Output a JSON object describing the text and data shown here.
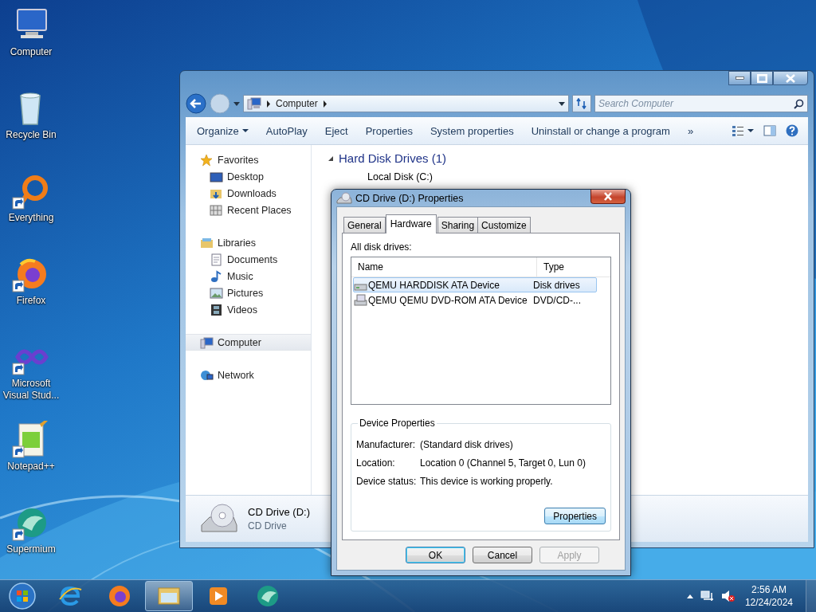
{
  "desktop_icons": [
    {
      "label": "Computer"
    },
    {
      "label": "Recycle Bin"
    },
    {
      "label": "Everything",
      "shortcut": true
    },
    {
      "label": "Firefox",
      "shortcut": true
    },
    {
      "label": "Microsoft Visual Stud...",
      "shortcut": true
    },
    {
      "label": "Notepad++",
      "shortcut": true
    },
    {
      "label": "Supermium",
      "shortcut": true
    }
  ],
  "explorer": {
    "address": {
      "crumbs": [
        "Computer"
      ]
    },
    "search": {
      "placeholder": "Search Computer"
    },
    "toolbar": [
      {
        "label": "Organize",
        "kind": "menu"
      },
      {
        "label": "AutoPlay",
        "kind": "button"
      },
      {
        "label": "Eject",
        "kind": "button"
      },
      {
        "label": "Properties",
        "kind": "button"
      },
      {
        "label": "System properties",
        "kind": "button"
      },
      {
        "label": "Uninstall or change a program",
        "kind": "button"
      },
      {
        "label": "»",
        "kind": "overflow"
      }
    ],
    "sidebar": [
      {
        "label": "Favorites",
        "selected": false,
        "children": [
          {
            "label": "Desktop",
            "selected": false
          },
          {
            "label": "Downloads",
            "selected": false
          },
          {
            "label": "Recent Places",
            "selected": false
          }
        ]
      },
      {
        "label": "Libraries",
        "selected": false,
        "children": [
          {
            "label": "Documents",
            "selected": false
          },
          {
            "label": "Music",
            "selected": false
          },
          {
            "label": "Pictures",
            "selected": false
          },
          {
            "label": "Videos",
            "selected": false
          }
        ]
      },
      {
        "label": "Computer",
        "selected": true
      },
      {
        "label": "Network",
        "selected": false
      }
    ],
    "groups": [
      {
        "label": "Hard Disk Drives (1)",
        "expanded": true,
        "items": [
          "Local Disk (C:)"
        ]
      }
    ],
    "details": {
      "name": "CD Drive (D:)",
      "type": "CD Drive"
    }
  },
  "dialog": {
    "title": "CD Drive (D:) Properties",
    "tabs": [
      {
        "label": "General",
        "selected": false
      },
      {
        "label": "Hardware",
        "selected": true
      },
      {
        "label": "Sharing",
        "selected": false
      },
      {
        "label": "Customize",
        "selected": false
      }
    ],
    "list_label": "All disk drives:",
    "columns": [
      "Name",
      "Type"
    ],
    "rows": [
      {
        "name": "QEMU HARDDISK ATA Device",
        "type": "Disk drives",
        "selected": true
      },
      {
        "name": "QEMU QEMU DVD-ROM ATA Device",
        "type": "DVD/CD-...",
        "selected": false
      }
    ],
    "group": {
      "title": "Device Properties",
      "fields": [
        {
          "label": "Manufacturer:",
          "value": "(Standard disk drives)"
        },
        {
          "label": "Location:",
          "value": "Location 0 (Channel 5, Target 0, Lun 0)"
        },
        {
          "label": "Device status:",
          "value": "This device is working properly."
        }
      ],
      "button": "Properties"
    },
    "buttons": [
      {
        "label": "OK",
        "default": true,
        "disabled": false
      },
      {
        "label": "Cancel",
        "default": false,
        "disabled": false
      },
      {
        "label": "Apply",
        "default": false,
        "disabled": true
      }
    ]
  },
  "taskbar": {
    "apps": [
      {
        "active": false
      },
      {
        "active": false
      },
      {
        "active": true
      },
      {
        "active": false
      },
      {
        "active": false
      }
    ],
    "clock": {
      "time": "2:56 AM",
      "date": "12/24/2024"
    }
  }
}
